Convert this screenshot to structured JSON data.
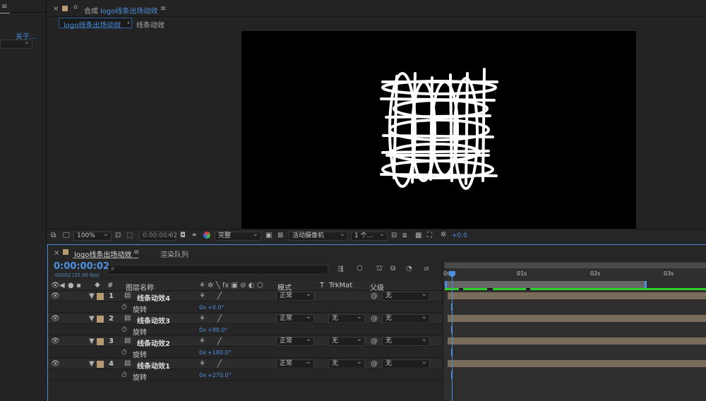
{
  "left_panel": {
    "about_label": "关于..."
  },
  "viewer": {
    "close": "×",
    "lock": "🔒",
    "comp_prefix": "合成",
    "comp_name": "logo线条出场动效",
    "menu": "≡",
    "crumb_active": "logo线条出场动效",
    "crumb_sep": "‹",
    "crumb_next": "线条动效"
  },
  "viewer_toolbar": {
    "zoom": "100%",
    "timecode": "0:00:00:02",
    "quality": "完整",
    "camera": "活动摄像机",
    "views": "1 个...",
    "exposure": "+0.0"
  },
  "timeline": {
    "tab_close": "×",
    "tab_name": "logo线条出场动效",
    "tab_menu": "≡",
    "render_queue": "渲染队列",
    "current_time": "0:00:00:02",
    "fps": "00002 (25.00 fps)",
    "search_icon": "⌕",
    "headers": {
      "num": "#",
      "layer_name": "图层名称",
      "mode": "模式",
      "t": "T",
      "trkmat": "TrkMat",
      "parent": "父级"
    },
    "ruler": {
      "start": "0s",
      "t1": "01s",
      "t2": "02s",
      "t3": "03s"
    },
    "layers": [
      {
        "num": "1",
        "name": "线条动效4",
        "mode": "正常",
        "trkmat": "",
        "parent": "无",
        "prop": "旋转",
        "value_prefix": "0x",
        "value": "+0.0°"
      },
      {
        "num": "2",
        "name": "线条动效3",
        "mode": "正常",
        "trkmat": "无",
        "parent": "无",
        "prop": "旋转",
        "value_prefix": "0x",
        "value": "+90.0°"
      },
      {
        "num": "3",
        "name": "线条动效2",
        "mode": "正常",
        "trkmat": "无",
        "parent": "无",
        "prop": "旋转",
        "value_prefix": "0x",
        "value": "+180.0°"
      },
      {
        "num": "4",
        "name": "线条动效1",
        "mode": "正常",
        "trkmat": "无",
        "parent": "无",
        "prop": "旋转",
        "value_prefix": "0x",
        "value": "+270.0°"
      }
    ]
  },
  "colors": {
    "accent": "#4d90e0",
    "label_sand": "#b79a72",
    "green": "#2bd12b"
  }
}
